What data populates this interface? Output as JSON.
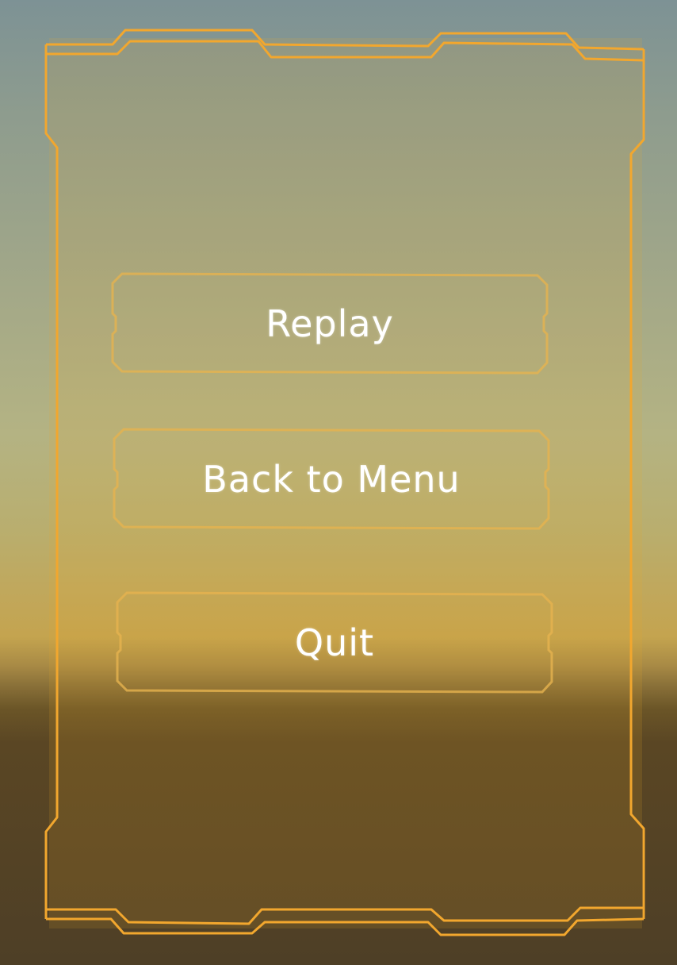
{
  "game_menu": {
    "buttons": [
      {
        "id": "replay",
        "label": "Replay"
      },
      {
        "id": "back_to_menu",
        "label": "Back to Menu"
      },
      {
        "id": "quit",
        "label": "Quit"
      }
    ]
  },
  "colors": {
    "frame_orange": "#f2a72e",
    "button_outline": "#e6b34f",
    "label_text": "#ffffff"
  }
}
